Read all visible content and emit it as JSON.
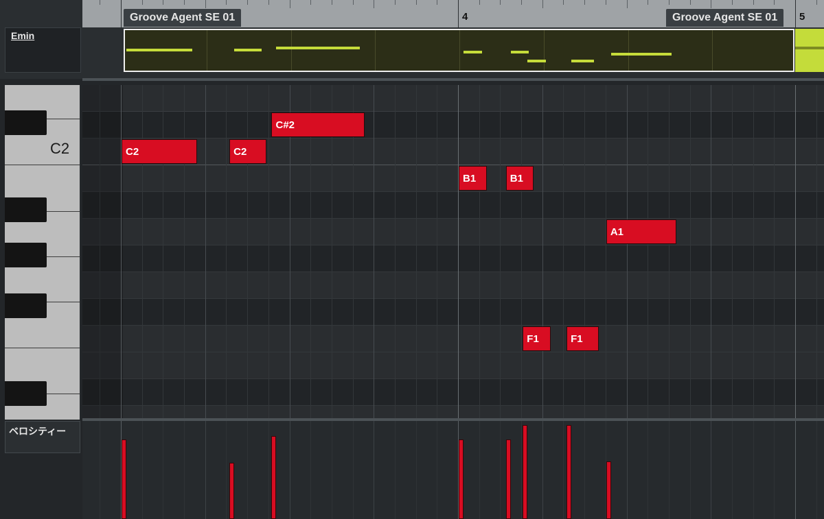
{
  "ruler": {
    "bar_numbers": [
      {
        "label": "4",
        "beat": 0
      },
      {
        "label": "5",
        "beat": 4
      }
    ],
    "part_tabs": [
      "Groove Agent SE 01",
      "Groove Agent SE 01"
    ]
  },
  "chord_track": {
    "chord": "Emin"
  },
  "keyboard": {
    "octave_label": "C2"
  },
  "velocity_lane": {
    "label": "ベロシティー"
  },
  "colors": {
    "note": "#d80d22",
    "part_fill": "#2c2e17",
    "part_note": "#c6dc3a"
  },
  "notes": [
    {
      "pitch": "C2",
      "start_beat": -4.0,
      "length_beats": 0.9,
      "velocity": 0.85
    },
    {
      "pitch": "C2",
      "start_beat": -2.72,
      "length_beats": 0.44,
      "velocity": 0.6
    },
    {
      "pitch": "C#2",
      "start_beat": -2.22,
      "length_beats": 1.1,
      "velocity": 0.88
    },
    {
      "pitch": "B1",
      "start_beat": 0.0,
      "length_beats": 0.33,
      "velocity": 0.85
    },
    {
      "pitch": "B1",
      "start_beat": 0.56,
      "length_beats": 0.33,
      "velocity": 0.85
    },
    {
      "pitch": "F1",
      "start_beat": 0.76,
      "length_beats": 0.33,
      "velocity": 1.0
    },
    {
      "pitch": "F1",
      "start_beat": 1.28,
      "length_beats": 0.38,
      "velocity": 1.0
    },
    {
      "pitch": "A1",
      "start_beat": 1.75,
      "length_beats": 0.83,
      "velocity": 0.61
    }
  ]
}
